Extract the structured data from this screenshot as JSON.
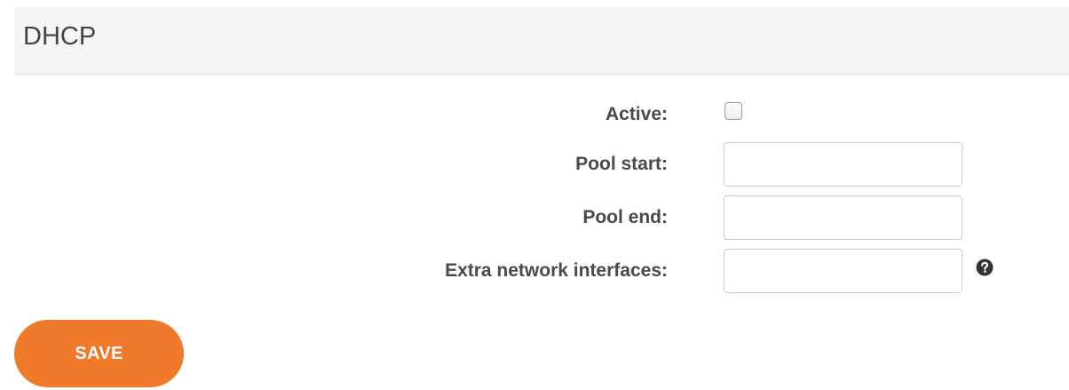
{
  "section": {
    "title": "DHCP"
  },
  "form": {
    "active": {
      "label": "Active:",
      "checked": false
    },
    "pool_start": {
      "label": "Pool start:",
      "value": ""
    },
    "pool_end": {
      "label": "Pool end:",
      "value": ""
    },
    "extra_interfaces": {
      "label": "Extra network interfaces:",
      "value": "",
      "help_icon": "question-circle-icon"
    }
  },
  "actions": {
    "save_label": "SAVE"
  },
  "colors": {
    "accent": "#f07a2b",
    "header_bg": "#f5f5f5",
    "label_text": "#4a4a4a"
  }
}
